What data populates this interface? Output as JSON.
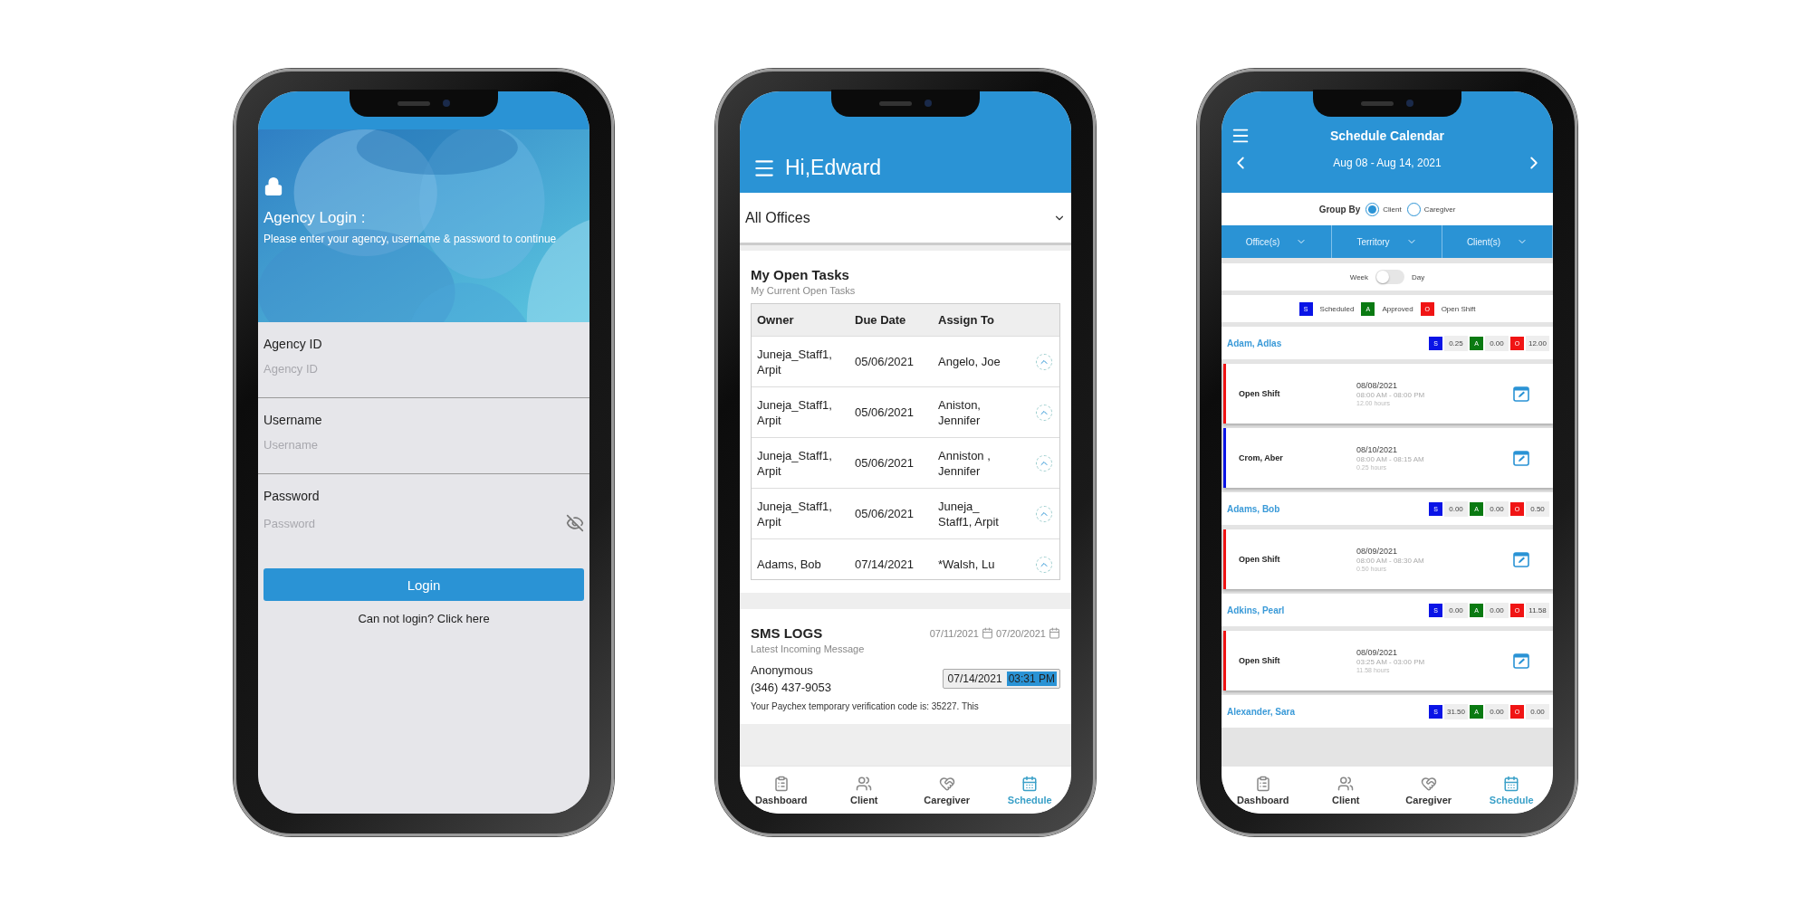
{
  "login": {
    "title": "Agency Login :",
    "subtitle": "Please enter your agency, username & password to continue",
    "fields": [
      {
        "label": "Agency ID",
        "placeholder": "Agency ID",
        "kind": "text"
      },
      {
        "label": "Username",
        "placeholder": "Username",
        "kind": "text"
      },
      {
        "label": "Password",
        "placeholder": "Password",
        "kind": "password"
      }
    ],
    "button": "Login",
    "help_link": "Can not login? Click here"
  },
  "dashboard": {
    "greeting": "Hi,Edward",
    "office_select": "All Offices",
    "tasks": {
      "title": "My Open Tasks",
      "subtitle": "My Current Open Tasks",
      "columns": [
        "Owner",
        "Due Date",
        "Assign To"
      ],
      "rows": [
        {
          "cells": [
            "Juneja_Staff1, Arpit",
            "05/06/2021",
            "Angelo, Joe"
          ]
        },
        {
          "cells": [
            "Juneja_Staff1, Arpit",
            "05/06/2021",
            "Aniston, Jennifer"
          ]
        },
        {
          "cells": [
            "Juneja_Staff1, Arpit",
            "05/06/2021",
            "Anniston , Jennifer"
          ]
        },
        {
          "cells": [
            "Juneja_Staff1, Arpit",
            "05/06/2021",
            "Juneja_ Staff1, Arpit"
          ]
        },
        {
          "cells": [
            "Adams, Bob",
            "07/14/2021",
            "*Walsh, Lu"
          ]
        }
      ]
    },
    "sms": {
      "title": "SMS LOGS",
      "date_from": "07/11/2021",
      "date_to": "07/20/2021",
      "subtitle": "Latest Incoming Message",
      "messages": [
        {
          "sender": "Anonymous",
          "phone": "(346) 437-9053",
          "date": "07/14/2021",
          "time": "03:31 PM",
          "text": "Your Paychex temporary verification code is: 35227. This"
        }
      ]
    },
    "nav": [
      {
        "label": "Dashboard",
        "selected": false
      },
      {
        "label": "Client",
        "selected": false
      },
      {
        "label": "Caregiver",
        "selected": false
      },
      {
        "label": "Schedule",
        "selected": true
      }
    ]
  },
  "schedule": {
    "title": "Schedule Calendar",
    "date_range": "Aug 08 - Aug 14, 2021",
    "group_by": {
      "label": "Group By",
      "options": [
        {
          "label": "Client",
          "selected": true
        },
        {
          "label": "Caregiver",
          "selected": false
        }
      ]
    },
    "filters": [
      "Office(s)",
      "Territory",
      "Client(s)"
    ],
    "view_toggle": {
      "left": "Week",
      "right": "Day",
      "on": false
    },
    "legend": [
      {
        "letter": "S",
        "label": "Scheduled",
        "color": "#0a14e6"
      },
      {
        "letter": "A",
        "label": "Approved",
        "color": "#0a7a12"
      },
      {
        "letter": "O",
        "label": "Open Shift",
        "color": "#f01414"
      }
    ],
    "groups": [
      {
        "name": "Adam, Adlas",
        "totals": [
          {
            "letter": "S",
            "value": "0.25",
            "color": "#0a14e6"
          },
          {
            "letter": "A",
            "value": "0.00",
            "color": "#0a7a12"
          },
          {
            "letter": "O",
            "value": "12.00",
            "color": "#f01414"
          }
        ],
        "shifts": [
          {
            "name": "Open Shift",
            "date": "08/08/2021",
            "time": "08:00 AM - 08:00 PM",
            "hours": "12.00 hours",
            "color": "#f01414"
          },
          {
            "name": "Crom, Aber",
            "date": "08/10/2021",
            "time": "08:00 AM - 08:15 AM",
            "hours": "0.25 hours",
            "color": "#0a14e6"
          }
        ]
      },
      {
        "name": "Adams, Bob",
        "totals": [
          {
            "letter": "S",
            "value": "0.00",
            "color": "#0a14e6"
          },
          {
            "letter": "A",
            "value": "0.00",
            "color": "#0a7a12"
          },
          {
            "letter": "O",
            "value": "0.50",
            "color": "#f01414"
          }
        ],
        "shifts": [
          {
            "name": "Open Shift",
            "date": "08/09/2021",
            "time": "08:00 AM - 08:30 AM",
            "hours": "0.50 hours",
            "color": "#f01414"
          }
        ]
      },
      {
        "name": "Adkins, Pearl",
        "totals": [
          {
            "letter": "S",
            "value": "0.00",
            "color": "#0a14e6"
          },
          {
            "letter": "A",
            "value": "0.00",
            "color": "#0a7a12"
          },
          {
            "letter": "O",
            "value": "11.58",
            "color": "#f01414"
          }
        ],
        "shifts": [
          {
            "name": "Open Shift",
            "date": "08/09/2021",
            "time": "03:25 AM - 03:00 PM",
            "hours": "11.58 hours",
            "color": "#f01414"
          }
        ]
      },
      {
        "name": "Alexander, Sara",
        "totals": [
          {
            "letter": "S",
            "value": "31.50",
            "color": "#0a14e6"
          },
          {
            "letter": "A",
            "value": "0.00",
            "color": "#0a7a12"
          },
          {
            "letter": "O",
            "value": "0.00",
            "color": "#f01414"
          }
        ]
      }
    ],
    "nav": [
      {
        "label": "Dashboard",
        "selected": false
      },
      {
        "label": "Client",
        "selected": false
      },
      {
        "label": "Caregiver",
        "selected": false
      },
      {
        "label": "Schedule",
        "selected": true
      }
    ]
  }
}
